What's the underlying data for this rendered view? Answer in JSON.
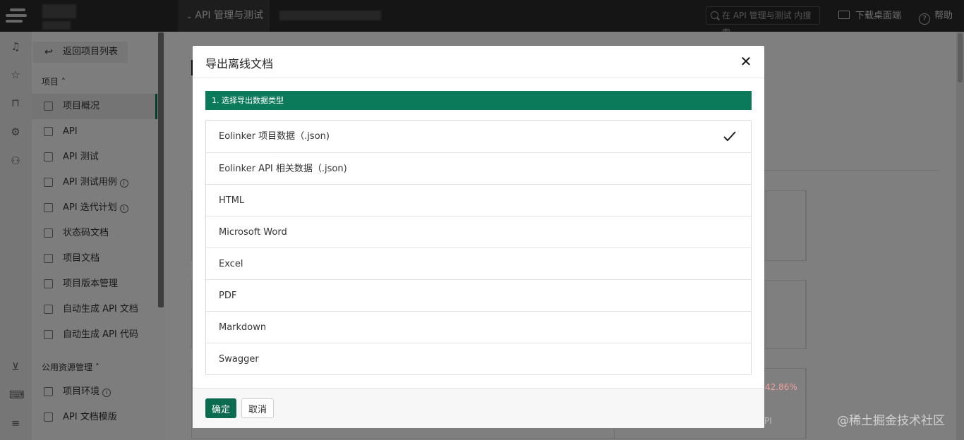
{
  "topbar": {
    "project_label": "API 管理与测试",
    "search_placeholder": "在 API 管理与测试 内搜索",
    "download_label": "下载桌面端",
    "help_label": "帮助"
  },
  "sidebar": {
    "back_label": "返回项目列表",
    "group_project": "项目",
    "items": [
      {
        "label": "项目概况",
        "active": true
      },
      {
        "label": "API"
      },
      {
        "label": "API 测试"
      },
      {
        "label": "API 测试用例",
        "info": true
      },
      {
        "label": "API 迭代计划",
        "info": true
      },
      {
        "label": "状态码文档"
      },
      {
        "label": "项目文档"
      },
      {
        "label": "项目版本管理"
      },
      {
        "label": "自动生成 API 文档"
      },
      {
        "label": "自动生成 API 代码"
      }
    ],
    "group_public": "公用资源管理",
    "public_items": [
      {
        "label": "项目环境",
        "info": true
      },
      {
        "label": "API 文档模版"
      }
    ]
  },
  "background": {
    "percent_text": "42.86%",
    "api_text": "PI"
  },
  "modal": {
    "title": "导出离线文档",
    "step_label": "1. 选择导出数据类型",
    "options": [
      {
        "label": "Eolinker 项目数据（.json)",
        "selected": true
      },
      {
        "label": "Eolinker API 相关数据（.json)"
      },
      {
        "label": "HTML"
      },
      {
        "label": "Microsoft Word"
      },
      {
        "label": "Excel"
      },
      {
        "label": "PDF"
      },
      {
        "label": "Markdown"
      },
      {
        "label": "Swagger"
      }
    ],
    "confirm_label": "确定",
    "cancel_label": "取消"
  },
  "watermark": "@稀土掘金技术社区",
  "colors": {
    "accent": "#0b7a5a",
    "topbar": "#2b2b2b"
  }
}
